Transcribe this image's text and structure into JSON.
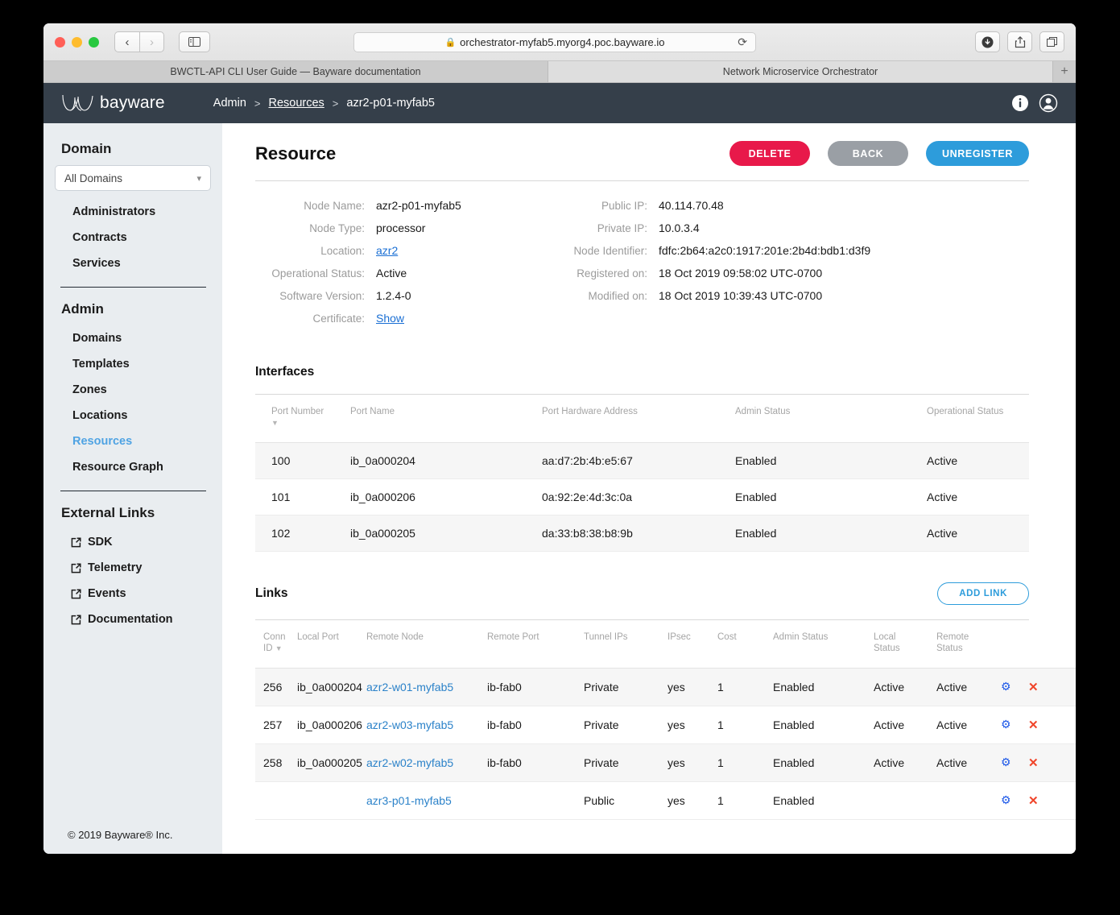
{
  "browser": {
    "url": "orchestrator-myfab5.myorg4.poc.bayware.io",
    "lock_icon": "lock-icon",
    "reload_icon": "reload-icon",
    "back_icon": "chevron-left-icon",
    "forward_icon": "chevron-right-icon",
    "sidebar_toggle_icon": "sidebar-toggle-icon",
    "download_icon": "download-icon",
    "share_icon": "share-icon",
    "tabs_icon": "tab-overview-icon",
    "new_tab_label": "+",
    "tabs": [
      {
        "label": "BWCTL-API CLI User Guide — Bayware documentation",
        "active": false
      },
      {
        "label": "Network Microservice Orchestrator",
        "active": true
      }
    ]
  },
  "app_header": {
    "logo_text": "bayware",
    "breadcrumb": {
      "root": "Admin",
      "sep": ">",
      "link": "Resources",
      "current": "azr2-p01-myfab5"
    },
    "info_icon": "info-icon",
    "account_icon": "user-account-icon"
  },
  "sidebar": {
    "domain_heading": "Domain",
    "domain_select_value": "All Domains",
    "domain_items": [
      "Administrators",
      "Contracts",
      "Services"
    ],
    "admin_heading": "Admin",
    "admin_items": [
      {
        "label": "Domains",
        "active": false
      },
      {
        "label": "Templates",
        "active": false
      },
      {
        "label": "Zones",
        "active": false
      },
      {
        "label": "Locations",
        "active": false
      },
      {
        "label": "Resources",
        "active": true
      },
      {
        "label": "Resource Graph",
        "active": false
      }
    ],
    "external_heading": "External Links",
    "external_items": [
      "SDK",
      "Telemetry",
      "Events",
      "Documentation"
    ],
    "footer": "© 2019 Bayware® Inc."
  },
  "main": {
    "page_title": "Resource",
    "buttons": {
      "delete": "DELETE",
      "back": "BACK",
      "unregister": "UNREGISTER"
    },
    "details_left": [
      {
        "label": "Node Name:",
        "value": "azr2-p01-myfab5",
        "link": false
      },
      {
        "label": "Node Type:",
        "value": "processor",
        "link": false
      },
      {
        "label": "Location:",
        "value": "azr2",
        "link": true
      },
      {
        "label": "Operational Status:",
        "value": "Active",
        "link": false
      },
      {
        "label": "Software Version:",
        "value": "1.2.4-0",
        "link": false
      },
      {
        "label": "Certificate:",
        "value": "Show",
        "link": true
      }
    ],
    "details_right": [
      {
        "label": "Public IP:",
        "value": "40.114.70.48",
        "link": false
      },
      {
        "label": "Private IP:",
        "value": "10.0.3.4",
        "link": false
      },
      {
        "label": "Node Identifier:",
        "value": "fdfc:2b64:a2c0:1917:201e:2b4d:bdb1:d3f9",
        "link": false
      },
      {
        "label": "Registered on:",
        "value": "18 Oct 2019 09:58:02 UTC-0700",
        "link": false
      },
      {
        "label": "Modified on:",
        "value": "18 Oct 2019 10:39:43 UTC-0700",
        "link": false
      }
    ],
    "interfaces": {
      "title": "Interfaces",
      "columns": [
        "Port Number",
        "Port Name",
        "Port Hardware Address",
        "Admin Status",
        "Operational Status"
      ],
      "sorted_column": 0,
      "sort_arrow": "▼",
      "rows": [
        {
          "port_number": "100",
          "port_name": "ib_0a000204",
          "hw_address": "aa:d7:2b:4b:e5:67",
          "admin_status": "Enabled",
          "operational_status": "Active"
        },
        {
          "port_number": "101",
          "port_name": "ib_0a000206",
          "hw_address": "0a:92:2e:4d:3c:0a",
          "admin_status": "Enabled",
          "operational_status": "Active"
        },
        {
          "port_number": "102",
          "port_name": "ib_0a000205",
          "hw_address": "da:33:b8:38:b8:9b",
          "admin_status": "Enabled",
          "operational_status": "Active"
        }
      ]
    },
    "links": {
      "title": "Links",
      "add_button": "ADD LINK",
      "columns": [
        "Conn ID",
        "Local Port",
        "Remote Node",
        "Remote Port",
        "Tunnel IPs",
        "IPsec",
        "Cost",
        "Admin Status",
        "Local Status",
        "Remote Status"
      ],
      "sort_arrow": "▼",
      "gear_icon": "settings-gear-icon",
      "delete_icon": "delete-x-icon",
      "rows": [
        {
          "conn_id": "256",
          "local_port": "ib_0a000204",
          "remote_node": "azr2-w01-myfab5",
          "remote_port": "ib-fab0",
          "tunnel_ips": "Private",
          "ipsec": "yes",
          "cost": "1",
          "admin_status": "Enabled",
          "local_status": "Active",
          "remote_status": "Active"
        },
        {
          "conn_id": "257",
          "local_port": "ib_0a000206",
          "remote_node": "azr2-w03-myfab5",
          "remote_port": "ib-fab0",
          "tunnel_ips": "Private",
          "ipsec": "yes",
          "cost": "1",
          "admin_status": "Enabled",
          "local_status": "Active",
          "remote_status": "Active"
        },
        {
          "conn_id": "258",
          "local_port": "ib_0a000205",
          "remote_node": "azr2-w02-myfab5",
          "remote_port": "ib-fab0",
          "tunnel_ips": "Private",
          "ipsec": "yes",
          "cost": "1",
          "admin_status": "Enabled",
          "local_status": "Active",
          "remote_status": "Active"
        },
        {
          "conn_id": "",
          "local_port": "",
          "remote_node": "azr3-p01-myfab5",
          "remote_port": "",
          "tunnel_ips": "Public",
          "ipsec": "yes",
          "cost": "1",
          "admin_status": "Enabled",
          "local_status": "",
          "remote_status": ""
        }
      ]
    }
  },
  "colors": {
    "header_bg": "#353f4a",
    "sidebar_bg": "#e9edf0",
    "accent_blue": "#2d9cdb",
    "danger_red": "#e8194a",
    "neutral_gray": "#9a9fa5",
    "link_blue": "#2b82c9",
    "gear_blue": "#1a56e8",
    "x_red": "#f0452a"
  }
}
